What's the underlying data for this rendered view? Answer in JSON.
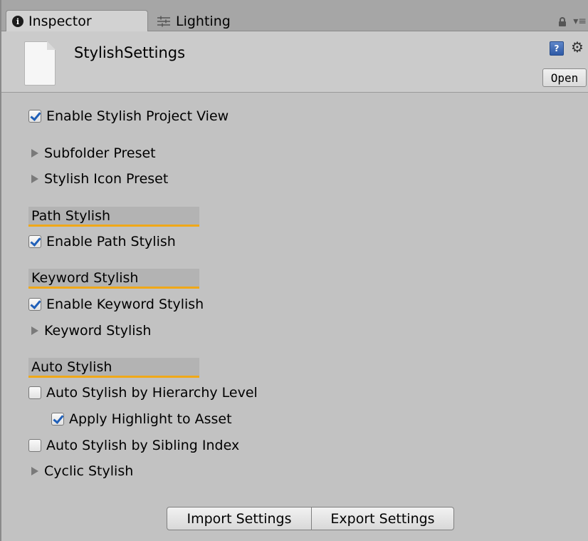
{
  "tabs": {
    "inspector": "Inspector",
    "lighting": "Lighting"
  },
  "header": {
    "asset_name": "StylishSettings",
    "open_label": "Open"
  },
  "options": {
    "enable_stylish_project_view": {
      "label": "Enable Stylish Project View",
      "checked": true
    },
    "subfolder_preset": "Subfolder Preset",
    "stylish_icon_preset": "Stylish Icon Preset"
  },
  "sections": {
    "path": {
      "title": "Path Stylish",
      "enable": {
        "label": "Enable Path Stylish",
        "checked": true
      }
    },
    "keyword": {
      "title": "Keyword Stylish",
      "enable": {
        "label": "Enable Keyword Stylish",
        "checked": true
      },
      "foldout": "Keyword Stylish"
    },
    "auto": {
      "title": "Auto Stylish",
      "by_hierarchy": {
        "label": "Auto Stylish by Hierarchy Level",
        "checked": false
      },
      "apply_highlight": {
        "label": "Apply Highlight to Asset",
        "checked": true
      },
      "by_sibling": {
        "label": "Auto Stylish by Sibling Index",
        "checked": false
      },
      "cyclic": "Cyclic Stylish"
    }
  },
  "buttons": {
    "import": "Import Settings",
    "export": "Export Settings"
  },
  "colors": {
    "section_underline": "#f0a818",
    "checkmark": "#1f5fb8",
    "panel_bg": "#c2c2c2"
  }
}
